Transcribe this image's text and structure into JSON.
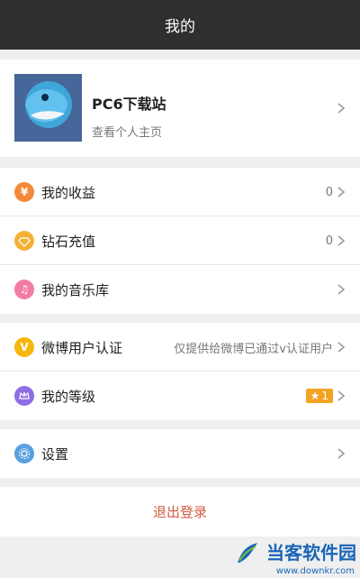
{
  "header": {
    "title": "我的"
  },
  "profile": {
    "name": "PC6下载站",
    "subtitle": "查看个人主页"
  },
  "section1": [
    {
      "label": "我的收益",
      "value": "0",
      "icon": "yen-icon",
      "color": "#f28a3a"
    },
    {
      "label": "钻石充值",
      "value": "0",
      "icon": "diamond-icon",
      "color": "#f5b136"
    },
    {
      "label": "我的音乐库",
      "value": "",
      "icon": "music-icon",
      "color": "#f27ba6"
    }
  ],
  "section2": [
    {
      "label": "微博用户认证",
      "value": "仅提供给微博已通过v认证用户",
      "icon": "v-icon",
      "color": "#f5b70c"
    },
    {
      "label": "我的等级",
      "value": "1",
      "icon": "crown-icon",
      "color": "#8f6ee5"
    }
  ],
  "section3": [
    {
      "label": "设置",
      "value": "",
      "icon": "gear-icon",
      "color": "#5aa0e0"
    }
  ],
  "logout": {
    "label": "退出登录"
  },
  "watermark": {
    "text": "当客软件园",
    "url": "www.downkr.com"
  }
}
